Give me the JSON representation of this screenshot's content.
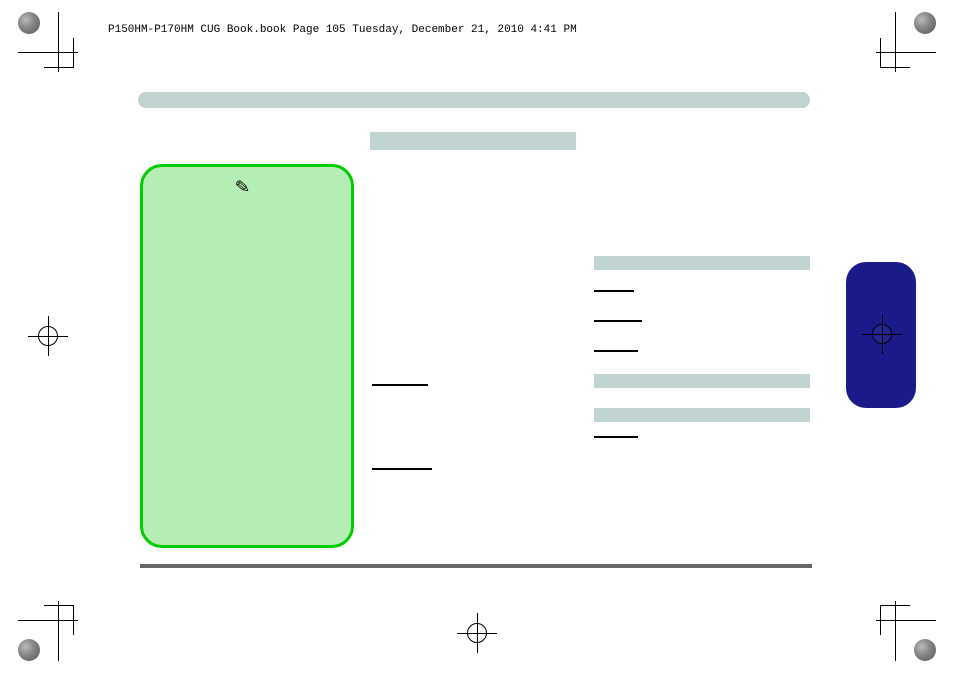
{
  "header": {
    "text": "P150HM-P170HM CUG Book.book  Page 105  Tuesday, December 21, 2010  4:41 PM"
  },
  "icons": {
    "pen": "✎"
  }
}
